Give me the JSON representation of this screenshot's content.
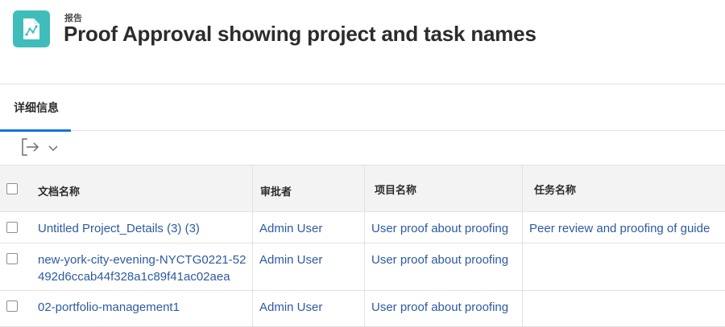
{
  "header": {
    "kicker": "报告",
    "title": "Proof Approval showing project and task names",
    "icon": "report-chart-icon",
    "icon_color": "#3fbdbb"
  },
  "tabs": [
    {
      "label": "详细信息",
      "active": true
    }
  ],
  "accent_color": "#1473e6",
  "link_color": "#2c5aa0",
  "toolbar": {
    "export_icon": "export-icon",
    "dropdown_icon": "chevron-down-icon"
  },
  "table": {
    "columns": [
      "文档名称",
      "审批者",
      "项目名称",
      "任务名称"
    ],
    "rows": [
      {
        "document": "Untitled Project_Details (3) (3)",
        "approver": "Admin User",
        "project": "User proof about proofing",
        "task": "Peer review and proofing of guide"
      },
      {
        "document": "new-york-city-evening-NYCTG0221-52492d6ccab44f328a1c89f41ac02aea",
        "approver": "Admin User",
        "project": "User proof about proofing",
        "task": ""
      },
      {
        "document": "02-portfolio-management1",
        "approver": "Admin User",
        "project": "User proof about proofing",
        "task": ""
      }
    ]
  }
}
